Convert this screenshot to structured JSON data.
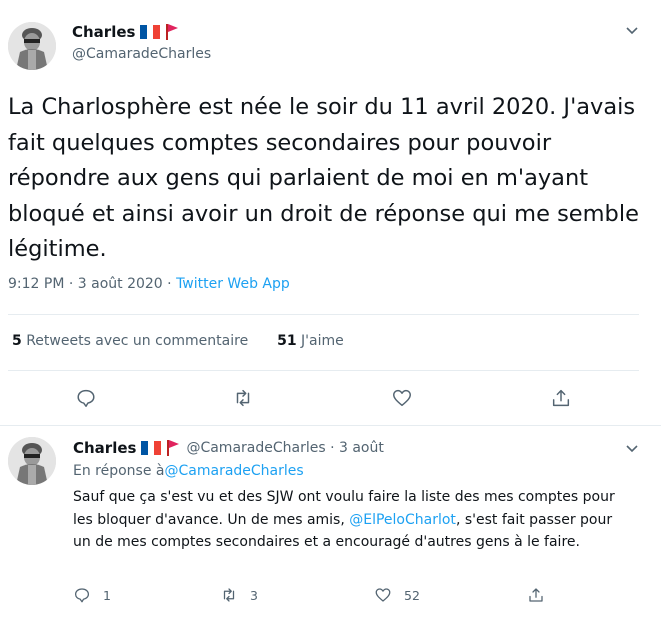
{
  "main_tweet": {
    "display_name": "Charles",
    "handle": "@CamaradeCharles",
    "text": "La Charlosphère est née le soir du 11 avril 2020. J'avais fait quelques comptes secondaires pour pouvoir répondre aux gens qui parlaient de moi en m'ayant bloqué et ainsi avoir un droit de réponse qui me semble légitime.",
    "time": "9:12 PM · 3 août 2020 · ",
    "source": "Twitter Web App",
    "retweets_count": "5",
    "retweets_label": " Retweets avec un commentaire",
    "likes_count": "51",
    "likes_label": " J'aime"
  },
  "reply_tweet": {
    "display_name": "Charles",
    "handle_date": "@CamaradeCharles · 3 août",
    "in_reply_prefix": "En réponse à ",
    "in_reply_handle": "@CamaradeCharles",
    "text_part1": "Sauf que ça s'est vu et des SJW ont voulu faire la liste des mes comptes pour les bloquer d'avance. Un de mes amis, ",
    "mention": "@ElPeloCharlot",
    "text_part2": ", s'est fait passer pour un de mes comptes secondaires et a encouragé d'autres gens à le faire.",
    "reply_count": "1",
    "retweet_count": "3",
    "like_count": "52"
  },
  "icons": {
    "flag_fr": "flag-france-icon",
    "flag_red": "red-flag-icon",
    "chevron": "chevron-down-icon",
    "reply": "reply-icon",
    "retweet": "retweet-icon",
    "like": "heart-icon",
    "share": "share-icon"
  },
  "colors": {
    "accent": "#1da1f2",
    "secondary_text": "#536471",
    "border": "#e6ecf0"
  }
}
